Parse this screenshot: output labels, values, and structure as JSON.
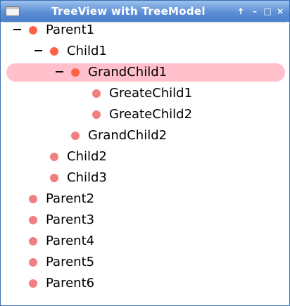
{
  "window": {
    "title": "TreeView with TreeModel"
  },
  "titlebar_buttons": {
    "pin": "🠅",
    "minimize": "–",
    "maximize": "□",
    "close": "×"
  },
  "colors": {
    "expanded_dot": "#ff6347",
    "collapsed_dot": "#f08080",
    "selection": "#ffc0cb"
  },
  "tree": [
    {
      "label": "Parent1",
      "depth": 0,
      "expanded": true,
      "selected": false
    },
    {
      "label": "Child1",
      "depth": 1,
      "expanded": true,
      "selected": false
    },
    {
      "label": "GrandChild1",
      "depth": 2,
      "expanded": true,
      "selected": true
    },
    {
      "label": "GreateChild1",
      "depth": 3,
      "expanded": false,
      "selected": false
    },
    {
      "label": "GreateChild2",
      "depth": 3,
      "expanded": false,
      "selected": false
    },
    {
      "label": "GrandChild2",
      "depth": 2,
      "expanded": false,
      "selected": false
    },
    {
      "label": "Child2",
      "depth": 1,
      "expanded": false,
      "selected": false
    },
    {
      "label": "Child3",
      "depth": 1,
      "expanded": false,
      "selected": false
    },
    {
      "label": "Parent2",
      "depth": 0,
      "expanded": false,
      "selected": false
    },
    {
      "label": "Parent3",
      "depth": 0,
      "expanded": false,
      "selected": false
    },
    {
      "label": "Parent4",
      "depth": 0,
      "expanded": false,
      "selected": false
    },
    {
      "label": "Parent5",
      "depth": 0,
      "expanded": false,
      "selected": false
    },
    {
      "label": "Parent6",
      "depth": 0,
      "expanded": false,
      "selected": false
    }
  ]
}
